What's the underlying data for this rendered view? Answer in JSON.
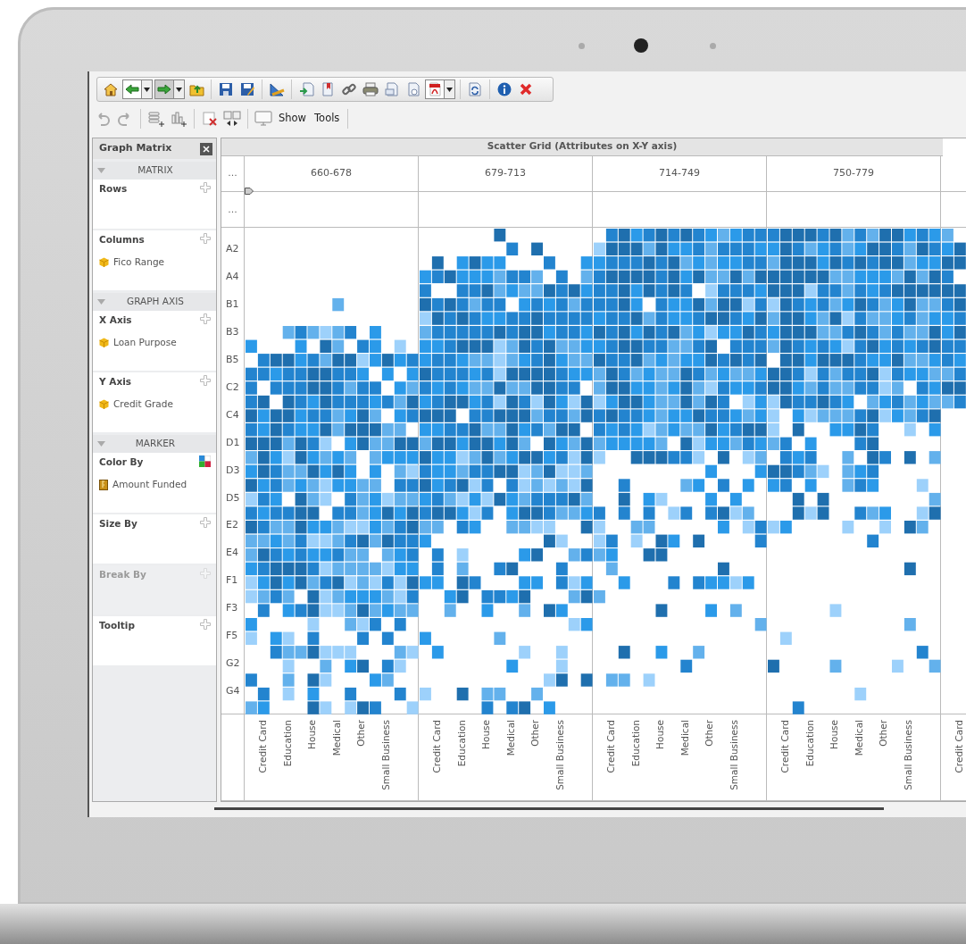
{
  "toolbar_secondary": {
    "labels": [
      "Show",
      "Tools"
    ]
  },
  "sidebar": {
    "title": "Graph Matrix",
    "sections": [
      {
        "header": "MATRIX",
        "fields": [
          {
            "label": "Rows",
            "kind": "add",
            "disabled": false
          },
          {
            "label": "Columns",
            "kind": "add",
            "disabled": false,
            "items": [
              {
                "text": "Fico Range",
                "kind": "attribute"
              }
            ]
          }
        ]
      },
      {
        "header": "GRAPH AXIS",
        "fields": [
          {
            "label": "X Axis",
            "kind": "add",
            "disabled": false,
            "items": [
              {
                "text": "Loan Purpose",
                "kind": "attribute"
              }
            ]
          },
          {
            "label": "Y Axis",
            "kind": "add",
            "disabled": false,
            "items": [
              {
                "text": "Credit Grade",
                "kind": "attribute"
              }
            ]
          }
        ]
      },
      {
        "header": "MARKER",
        "fields": [
          {
            "label": "Color By",
            "kind": "color",
            "disabled": false,
            "items": [
              {
                "text": "Amount Funded",
                "kind": "metric"
              }
            ]
          },
          {
            "label": "Size By",
            "kind": "add",
            "disabled": false
          },
          {
            "label": "Break By",
            "kind": "add",
            "disabled": true
          },
          {
            "label": "Tooltip",
            "kind": "add",
            "disabled": false
          }
        ]
      }
    ]
  },
  "grid": {
    "title": "Scatter Grid (Attributes on X-Y axis)",
    "corner_labels": [
      "...",
      "..."
    ],
    "row_labels": [
      "A2",
      "A4",
      "B1",
      "B3",
      "B5",
      "C2",
      "C4",
      "D1",
      "D3",
      "D5",
      "E2",
      "E4",
      "F1",
      "F3",
      "F5",
      "G2",
      "G4"
    ],
    "panels": [
      {
        "header": "660-678",
        "x_labels": [
          "Credit Card",
          "Education",
          "House",
          "Medical",
          "Other",
          "Small Business"
        ]
      },
      {
        "header": "679-713",
        "x_labels": [
          "Credit Card",
          "Education",
          "House",
          "Medical",
          "Other",
          "Small Business"
        ]
      },
      {
        "header": "714-749",
        "x_labels": [
          "Credit Card",
          "Education",
          "House",
          "Medical",
          "Other",
          "Small Business"
        ]
      },
      {
        "header": "750-779",
        "x_labels": [
          "Credit Card",
          "Education",
          "House",
          "Medical",
          "Other",
          "Small Business"
        ]
      },
      {
        "x_labels": [
          "Credit Card"
        ]
      }
    ]
  }
}
